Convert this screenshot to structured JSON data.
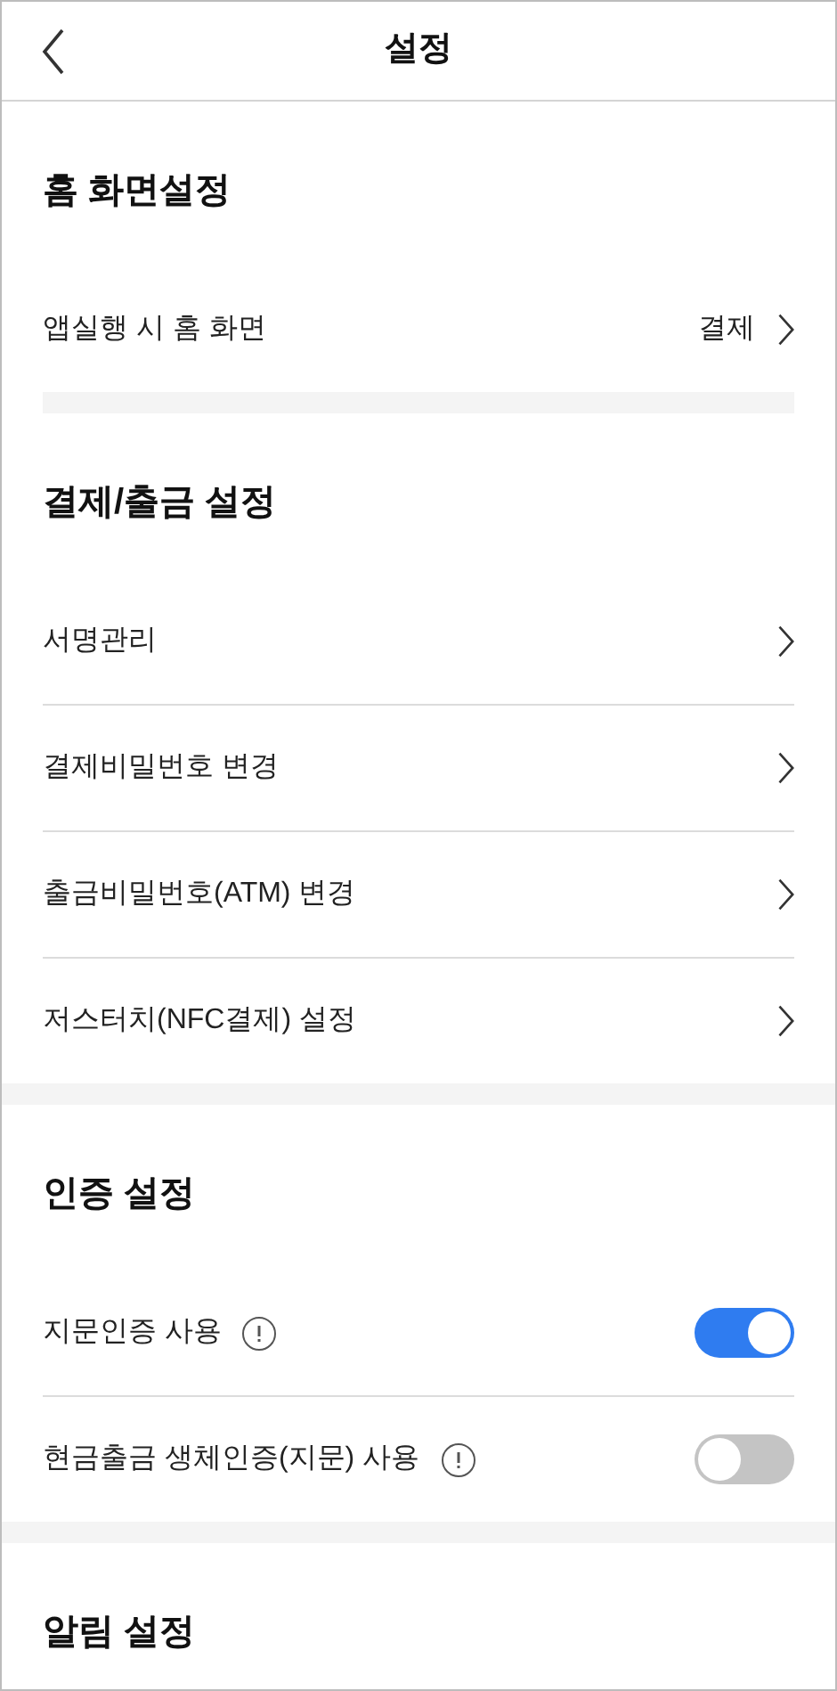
{
  "header": {
    "title": "설정"
  },
  "sections": [
    {
      "title": "홈 화면설정",
      "items": [
        {
          "kind": "link",
          "label": "앱실행 시 홈 화면",
          "value": "결제"
        }
      ]
    },
    {
      "title": "결제/출금 설정",
      "items": [
        {
          "kind": "link",
          "label": "서명관리"
        },
        {
          "kind": "link",
          "label": "결제비밀번호 변경"
        },
        {
          "kind": "link",
          "label": "출금비밀번호(ATM) 변경"
        },
        {
          "kind": "link",
          "label": "저스터치(NFC결제) 설정"
        }
      ]
    },
    {
      "title": "인증 설정",
      "items": [
        {
          "kind": "toggle",
          "label": "지문인증 사용",
          "on": true
        },
        {
          "kind": "toggle",
          "label": "현금출금 생체인증(지문) 사용",
          "on": false
        }
      ]
    },
    {
      "title": "알림 설정"
    }
  ]
}
